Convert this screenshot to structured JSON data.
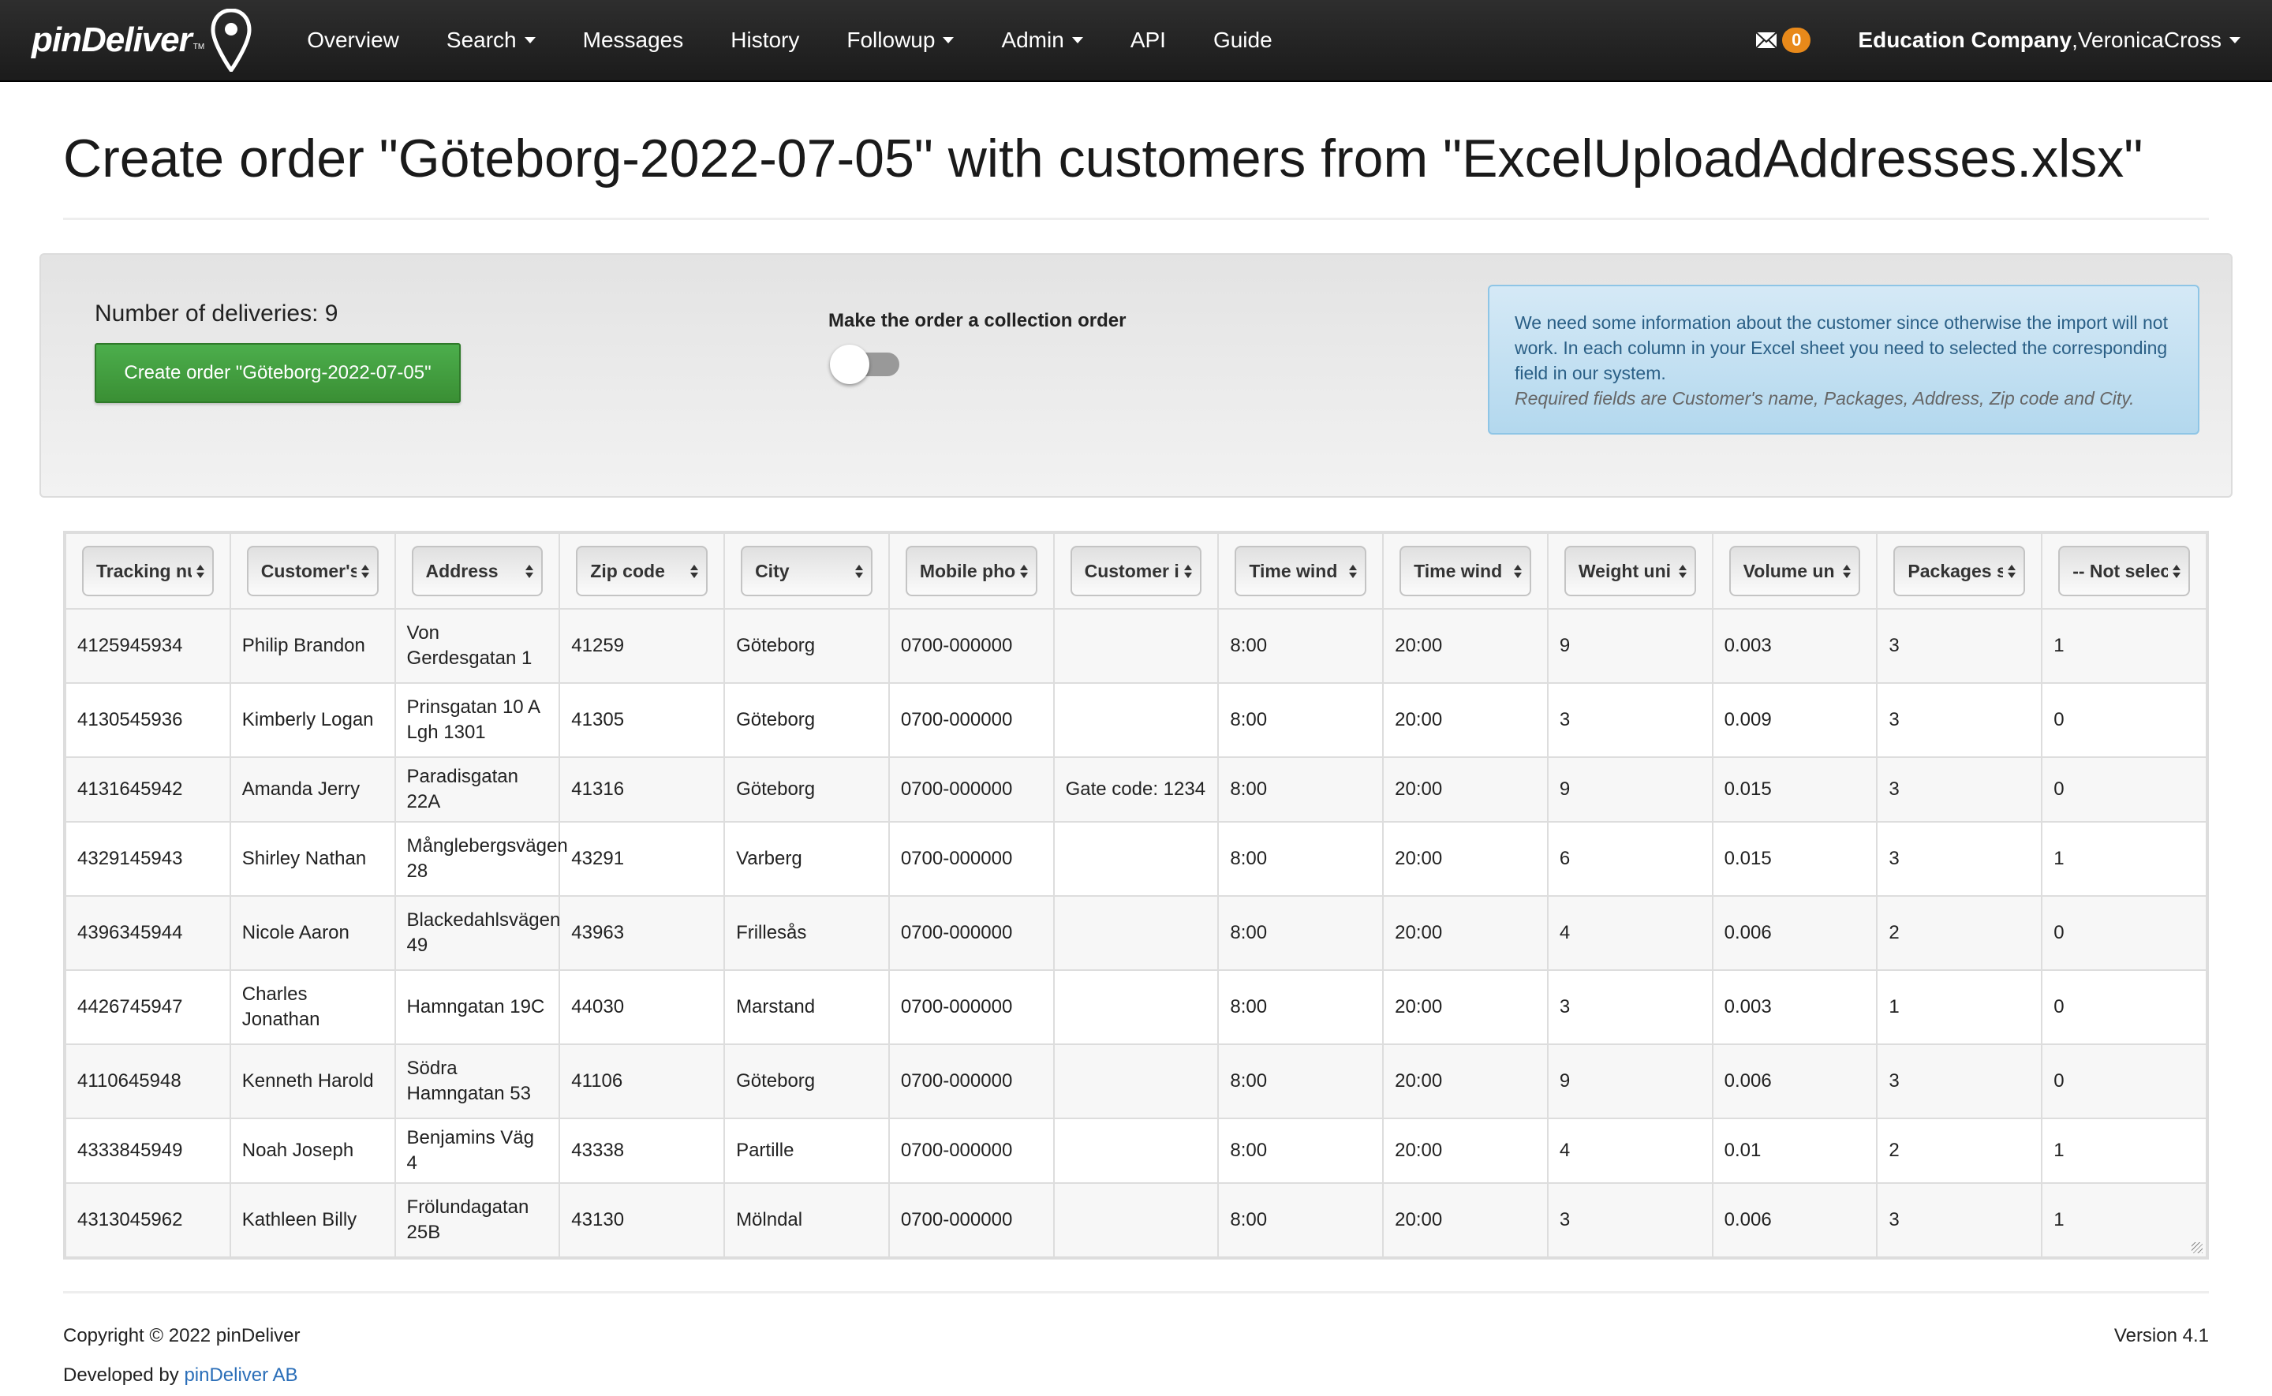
{
  "nav": {
    "brand": "pinDeliver",
    "brand_tm": "TM",
    "items": [
      {
        "label": "Overview",
        "dropdown": false
      },
      {
        "label": "Search",
        "dropdown": true
      },
      {
        "label": "Messages",
        "dropdown": false
      },
      {
        "label": "History",
        "dropdown": false
      },
      {
        "label": "Followup",
        "dropdown": true
      },
      {
        "label": "Admin",
        "dropdown": true
      },
      {
        "label": "API",
        "dropdown": false
      },
      {
        "label": "Guide",
        "dropdown": false
      }
    ],
    "message_icon": "envelope-icon",
    "message_count": "0",
    "company": "Education Company",
    "user_sep": ", ",
    "user": "VeronicaCross",
    "badge_color": "#e8891a"
  },
  "page": {
    "title": "Create order \"Göteborg-2022-07-05\" with customers from \"ExcelUploadAddresses.xlsx\""
  },
  "panel": {
    "deliveries_label": "Number of deliveries: 9",
    "create_button": "Create order \"Göteborg-2022-07-05\"",
    "collection_label": "Make the order a collection order",
    "collection_toggle_on": false,
    "info_text": "We need some information about the customer since otherwise the import will not work. In each column in your Excel sheet you need to selected the corresponding field in our system.",
    "info_required": "Required fields are Customer's name, Packages, Address, Zip code and City.",
    "button_color": "#43a340"
  },
  "table": {
    "columns": [
      "Tracking number",
      "Customer's name",
      "Address",
      "Zip code",
      "City",
      "Mobile phone",
      "Customer info",
      "Time window start",
      "Time window end",
      "Weight unit",
      "Volume unit",
      "Packages",
      "-- Not selected --"
    ],
    "column_display": [
      "Tracking nu",
      "Customer's",
      "Address",
      "Zip code",
      "City",
      "Mobile pho",
      "Customer i",
      "Time wind",
      "Time wind",
      "Weight uni",
      "Volume un",
      "Packages s",
      "-- Not selec"
    ],
    "rows": [
      [
        "4125945934",
        "Philip Brandon",
        "Von Gerdesgatan 1",
        "41259",
        "Göteborg",
        "0700-000000",
        "",
        "8:00",
        "20:00",
        "9",
        "0.003",
        "3",
        "1"
      ],
      [
        "4130545936",
        "Kimberly Logan",
        "Prinsgatan 10 A Lgh 1301",
        "41305",
        "Göteborg",
        "0700-000000",
        "",
        "8:00",
        "20:00",
        "3",
        "0.009",
        "3",
        "0"
      ],
      [
        "4131645942",
        "Amanda Jerry",
        "Paradisgatan 22A",
        "41316",
        "Göteborg",
        "0700-000000",
        "Gate code: 1234",
        "8:00",
        "20:00",
        "9",
        "0.015",
        "3",
        "0"
      ],
      [
        "4329145943",
        "Shirley Nathan",
        "Månglebergsvägen 28",
        "43291",
        "Varberg",
        "0700-000000",
        "",
        "8:00",
        "20:00",
        "6",
        "0.015",
        "3",
        "1"
      ],
      [
        "4396345944",
        "Nicole Aaron",
        "Blackedahlsvägen 49",
        "43963",
        "Frillesås",
        "0700-000000",
        "",
        "8:00",
        "20:00",
        "4",
        "0.006",
        "2",
        "0"
      ],
      [
        "4426745947",
        "Charles Jonathan",
        "Hamngatan 19C",
        "44030",
        "Marstand",
        "0700-000000",
        "",
        "8:00",
        "20:00",
        "3",
        "0.003",
        "1",
        "0"
      ],
      [
        "4110645948",
        "Kenneth Harold",
        "Södra Hamngatan 53",
        "41106",
        "Göteborg",
        "0700-000000",
        "",
        "8:00",
        "20:00",
        "9",
        "0.006",
        "3",
        "0"
      ],
      [
        "4333845949",
        "Noah Joseph",
        "Benjamins Väg 4",
        "43338",
        "Partille",
        "0700-000000",
        "",
        "8:00",
        "20:00",
        "4",
        "0.01",
        "2",
        "1"
      ],
      [
        "4313045962",
        "Kathleen Billy",
        "Frölundagatan 25B",
        "43130",
        "Mölndal",
        "0700-000000",
        "",
        "8:00",
        "20:00",
        "3",
        "0.006",
        "3",
        "1"
      ]
    ],
    "short_rows": [
      2,
      7
    ]
  },
  "footer": {
    "copyright": "Copyright © 2022 pinDeliver",
    "developed_by": "Developed by ",
    "developer_link": "pinDeliver AB",
    "version": "Version 4.1",
    "link_color": "#2a6eb8"
  }
}
